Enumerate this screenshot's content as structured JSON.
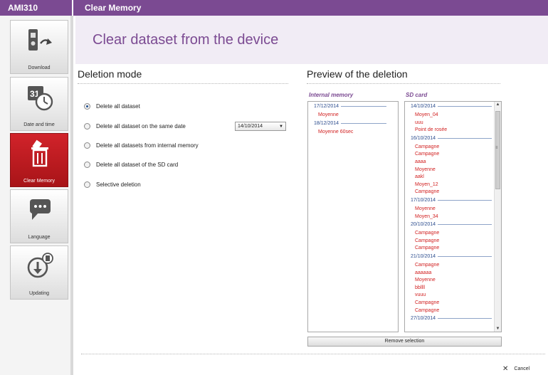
{
  "app": {
    "title": "AMI310"
  },
  "window": {
    "title": "Clear Memory"
  },
  "header": {
    "title": "Clear dataset from the device"
  },
  "sidebar": {
    "items": [
      {
        "label": "Download",
        "icon": "download-icon"
      },
      {
        "label": "Date and time",
        "icon": "calendar-clock-icon"
      },
      {
        "label": "Clear Memory",
        "icon": "trash-icon"
      },
      {
        "label": "Language",
        "icon": "speech-bubble-icon"
      },
      {
        "label": "Updating",
        "icon": "update-icon"
      }
    ],
    "active_index": 2
  },
  "deletion": {
    "title": "Deletion mode",
    "options": [
      "Delete all dataset",
      "Delete all dataset on the same date",
      "Delete all datasets from internal memory",
      "Delete all dataset of the SD card",
      "Selective deletion"
    ],
    "selected_index": 0,
    "date_value": "14/10/2014"
  },
  "preview": {
    "title": "Preview of the deletion",
    "internal_label": "Internal memory",
    "sd_label": "SD card",
    "internal": [
      {
        "type": "date",
        "text": "17/12/2014"
      },
      {
        "type": "item",
        "text": "Moyenne"
      },
      {
        "type": "date",
        "text": "18/12/2014"
      },
      {
        "type": "item",
        "text": "Moyenne 60sec"
      }
    ],
    "sd": [
      {
        "type": "date",
        "text": "14/10/2014"
      },
      {
        "type": "item",
        "text": "Moyen_04"
      },
      {
        "type": "item",
        "text": "uuu"
      },
      {
        "type": "item",
        "text": "Point de rosée"
      },
      {
        "type": "date",
        "text": "16/10/2014"
      },
      {
        "type": "item",
        "text": "Campagne"
      },
      {
        "type": "item",
        "text": "Campagne"
      },
      {
        "type": "item",
        "text": "aaaa"
      },
      {
        "type": "item",
        "text": "Moyenne"
      },
      {
        "type": "item",
        "text": "aakl"
      },
      {
        "type": "item",
        "text": "Moyen_12"
      },
      {
        "type": "item",
        "text": "Campagne"
      },
      {
        "type": "date",
        "text": "17/10/2014"
      },
      {
        "type": "item",
        "text": "Moyenne"
      },
      {
        "type": "item",
        "text": "Moyen_34"
      },
      {
        "type": "date",
        "text": "20/10/2014"
      },
      {
        "type": "item",
        "text": "Campagne"
      },
      {
        "type": "item",
        "text": "Campagne"
      },
      {
        "type": "item",
        "text": "Campagne"
      },
      {
        "type": "date",
        "text": "21/10/2014"
      },
      {
        "type": "item",
        "text": "Campagne"
      },
      {
        "type": "item",
        "text": "aaaaaa"
      },
      {
        "type": "item",
        "text": "Moyenne"
      },
      {
        "type": "item",
        "text": "bbllll"
      },
      {
        "type": "item",
        "text": "vuuu"
      },
      {
        "type": "item",
        "text": "Campagne"
      },
      {
        "type": "item",
        "text": "Campagne"
      },
      {
        "type": "date",
        "text": "27/10/2014"
      }
    ]
  },
  "buttons": {
    "remove_selection": "Remove selection",
    "cancel": "Cancel"
  },
  "colors": {
    "accent": "#7b4a92",
    "active": "#c41e24",
    "item_text": "#d11f1f",
    "date_text": "#2a4b8d"
  }
}
